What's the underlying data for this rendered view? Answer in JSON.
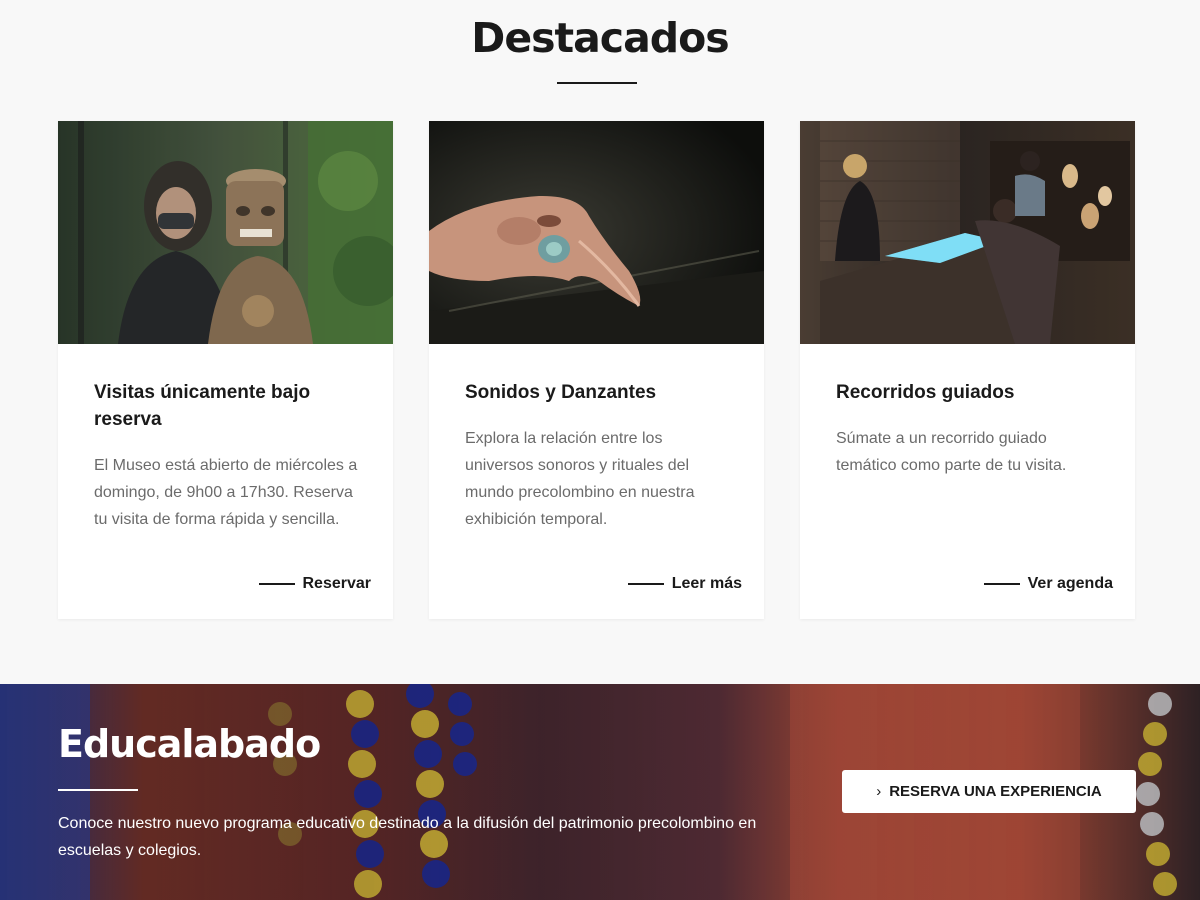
{
  "section": {
    "title": "Destacados"
  },
  "cards": [
    {
      "title": "Visitas únicamente bajo reserva",
      "text": "El Museo está abierto de miércoles a domingo, de 9h00 a 17h30. Reserva tu visita de forma rápida y sencilla.",
      "link": "Reservar",
      "icon": "arrow-dash-icon"
    },
    {
      "title": "Sonidos y Danzantes",
      "text": "Explora la relación entre los universos sonoros y rituales del mundo precolombino en nuestra exhibición temporal.",
      "link": "Leer más",
      "icon": "arrow-dash-icon"
    },
    {
      "title": "Recorridos guiados",
      "text": "Súmate a un recorrido guiado temático como parte de tu visita.",
      "link": "Ver agenda",
      "icon": "arrow-dash-icon"
    }
  ],
  "edu": {
    "title": "Educalabado",
    "text": "Conoce nuestro nuevo programa educativo destinado a la difusión del patrimonio precolombino en escuelas y colegios.",
    "button": "RESERVA UNA EXPERIENCIA",
    "button_icon": "chevron-right-icon"
  },
  "colors": {
    "text": "#1a1a1a",
    "muted": "#6b6b6b",
    "background": "#f8f8f8",
    "card": "#ffffff"
  }
}
